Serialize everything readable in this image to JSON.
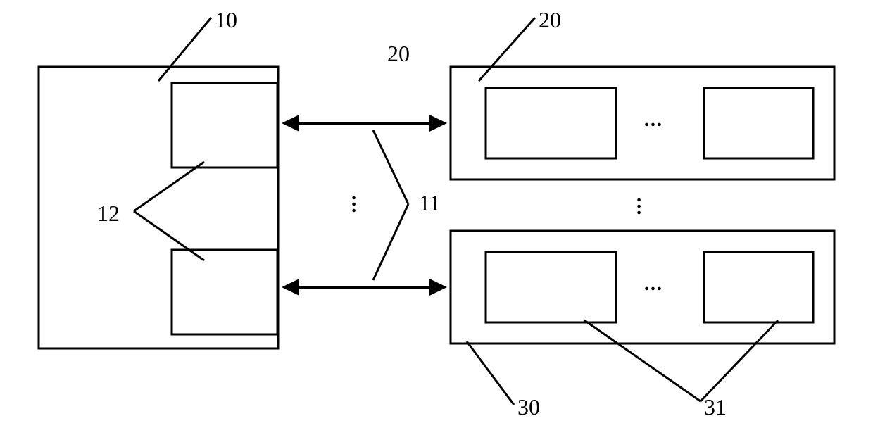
{
  "labels": {
    "l10": "10",
    "l20_top": "20",
    "l20_center": "20",
    "l11": "11",
    "l12": "12",
    "l30": "30",
    "l31": "31"
  },
  "ellipsis": {
    "e1": "...",
    "e2": "...",
    "e3": "...",
    "e4": "..."
  }
}
